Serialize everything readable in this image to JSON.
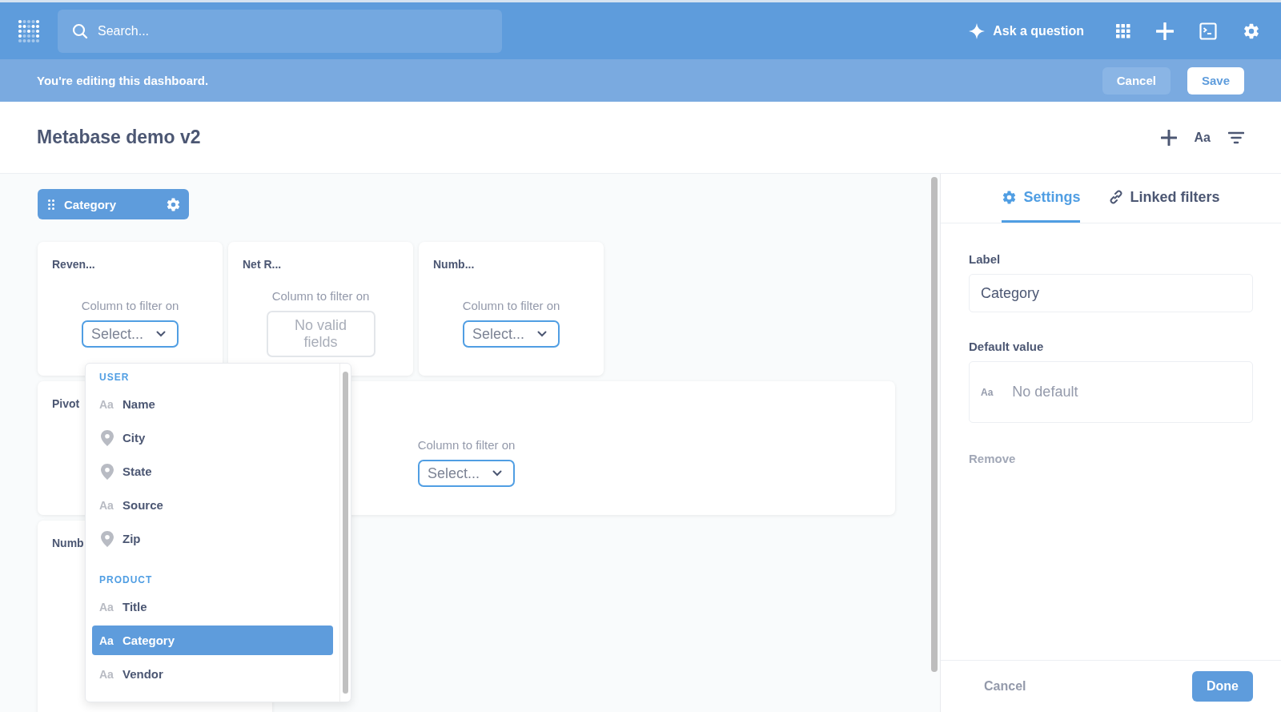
{
  "top_nav": {
    "search": {
      "placeholder": "Search..."
    },
    "ask_button": "Ask a question"
  },
  "edit_bar": {
    "message": "You're editing this dashboard.",
    "buttons": [
      {
        "label": "Cancel",
        "kind": "secondary"
      },
      {
        "label": "Save",
        "kind": "primary"
      }
    ]
  },
  "header": {
    "title": "Metabase demo v2",
    "text_button": "Aa"
  },
  "filter_chip": {
    "label": "Category"
  },
  "cards": [
    {
      "kind": "small",
      "title": "Reven...",
      "prompt": "Column to filter on",
      "select": {
        "label": "Select...",
        "disabled": false
      }
    },
    {
      "kind": "small",
      "title": "Net R...",
      "prompt": "Column to filter on",
      "select": {
        "label": "No valid fields",
        "disabled": true
      }
    },
    {
      "kind": "small",
      "title": "Numb...",
      "prompt": "Column to filter on",
      "select": {
        "label": "Select...",
        "disabled": false
      }
    },
    {
      "kind": "wide",
      "title": "Pivot",
      "prompt": "Column to filter on",
      "select": {
        "label": "Select...",
        "disabled": false
      }
    },
    {
      "kind": "tall",
      "title": "Numb"
    }
  ],
  "dropdown": {
    "groups": [
      {
        "heading": "USER",
        "items": [
          {
            "kind": "text",
            "glyph": "Aa",
            "label": "Name",
            "selected": false
          },
          {
            "kind": "location",
            "label": "City",
            "selected": false
          },
          {
            "kind": "location",
            "label": "State",
            "selected": false
          },
          {
            "kind": "text",
            "glyph": "Aa",
            "label": "Source",
            "selected": false
          },
          {
            "kind": "location",
            "label": "Zip",
            "selected": false
          }
        ]
      },
      {
        "heading": "PRODUCT",
        "items": [
          {
            "kind": "text",
            "glyph": "Aa",
            "label": "Title",
            "selected": false
          },
          {
            "kind": "text",
            "glyph": "Aa",
            "label": "Category",
            "selected": true
          },
          {
            "kind": "text",
            "glyph": "Aa",
            "label": "Vendor",
            "selected": false
          }
        ]
      }
    ]
  },
  "sidebar": {
    "tabs": [
      {
        "kind": "settings",
        "label": "Settings",
        "selected": true
      },
      {
        "kind": "link",
        "label": "Linked filters",
        "selected": false
      }
    ],
    "label_field": {
      "label": "Label",
      "value": "Category"
    },
    "default_field": {
      "label": "Default value",
      "glyph": "Aa",
      "placeholder": "No default"
    },
    "remove": "Remove",
    "footer": {
      "cancel": "Cancel",
      "done": "Done"
    }
  }
}
